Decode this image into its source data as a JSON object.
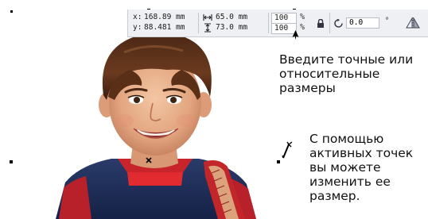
{
  "property_bar": {
    "x_label": "x:",
    "x_value": "168.89 mm",
    "y_label": "y:",
    "y_value": "88.481 mm",
    "width_value": "65.0 mm",
    "height_value": "73.0 mm",
    "scale_w": "100",
    "scale_h": "100",
    "percent": "%",
    "rotation_value": "0.0",
    "degree": "°"
  },
  "callouts": {
    "size_hint": "Введите точные или\nотносительные\nразмеры",
    "handles_hint": "С помощью\nактивных точек\nвы можете\nизменить ее\nразмер."
  },
  "icons": {
    "width_icon": "horizontal-arrows-icon",
    "height_icon": "vertical-arrows-icon",
    "lock_icon": "lock-ratio-icon",
    "rotate_icon": "rotate-icon",
    "mirror_icon": "mirror-icon",
    "center_marker": "center-x-marker",
    "cursor": "arrow-cursor-icon",
    "pick_cursor": "pen-cursor-icon"
  }
}
